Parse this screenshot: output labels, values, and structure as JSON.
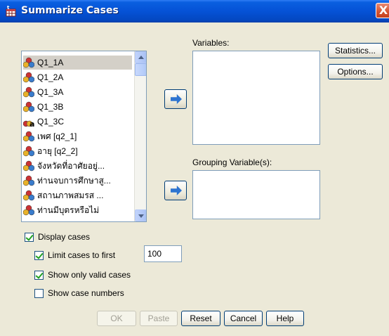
{
  "window": {
    "title": "Summarize Cases",
    "close_glyph": "X"
  },
  "variables_list": {
    "items": [
      {
        "label": "Q1_1A",
        "icon": "scale-variable-icon",
        "selected": true
      },
      {
        "label": "Q1_2A",
        "icon": "scale-variable-icon"
      },
      {
        "label": "Q1_3A",
        "icon": "scale-variable-icon"
      },
      {
        "label": "Q1_3B",
        "icon": "scale-variable-icon"
      },
      {
        "label": "Q1_3C",
        "icon": "string-variable-icon"
      },
      {
        "label": "เพศ [q2_1]",
        "icon": "scale-variable-icon"
      },
      {
        "label": "อายุ [q2_2]",
        "icon": "scale-variable-icon"
      },
      {
        "label": "จังหวัดที่อาศัยอยู่...",
        "icon": "scale-variable-icon"
      },
      {
        "label": "ท่านจบการศึกษาสู...",
        "icon": "scale-variable-icon"
      },
      {
        "label": "สถานภาพสมรส ...",
        "icon": "scale-variable-icon"
      },
      {
        "label": "ท่านมีบุตรหรือไม่",
        "icon": "scale-variable-icon"
      }
    ]
  },
  "variables_box": {
    "label": "Variables:"
  },
  "grouping_box": {
    "label": "Grouping Variable(s):"
  },
  "buttons": {
    "statistics": "Statistics...",
    "options": "Options...",
    "ok": "OK",
    "paste": "Paste",
    "reset": "Reset",
    "cancel": "Cancel",
    "help": "Help"
  },
  "options": {
    "display_cases": {
      "label": "Display cases",
      "checked": true
    },
    "limit_cases": {
      "label": "Limit cases to first",
      "checked": true,
      "value": "100"
    },
    "show_valid": {
      "label": "Show only valid cases",
      "checked": true
    },
    "show_numbers": {
      "label": "Show case numbers",
      "checked": false
    }
  },
  "colors": {
    "titlebar": "#0552d6",
    "dialog_bg": "#ece9d8",
    "arrow": "#2e74d0"
  }
}
